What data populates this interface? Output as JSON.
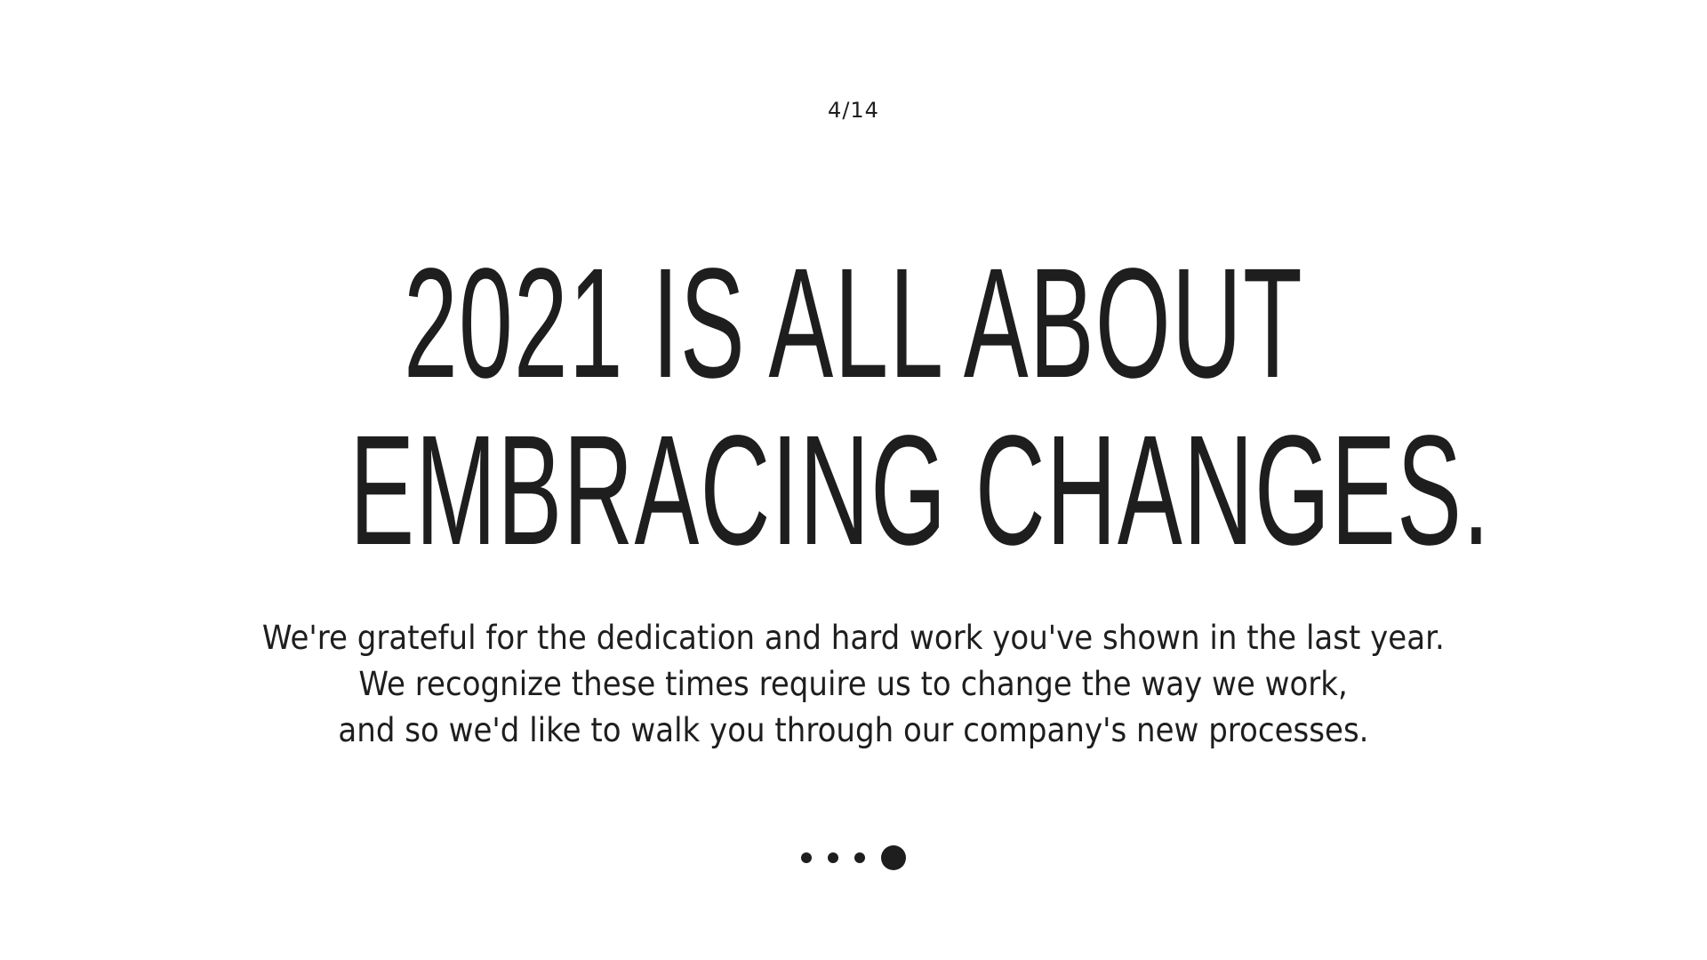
{
  "slide": {
    "counter": "4/14",
    "headline": {
      "line1": "2021 IS ALL ABOUT",
      "line2": "EMBRACING CHANGES."
    },
    "body": {
      "line1": "We're grateful for the dedication and hard work you've shown in the last year.",
      "line2": "We recognize these times require us to change the way we work,",
      "line3": "and so we'd like to walk you through our company's new processes."
    },
    "pager": {
      "total_dots": 4,
      "active_index": 3
    }
  },
  "colors": {
    "background": "#ffffff",
    "text": "#1e1e1e"
  }
}
